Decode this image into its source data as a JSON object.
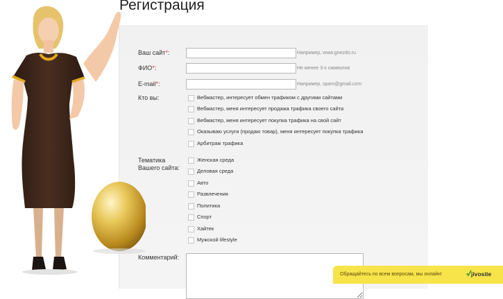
{
  "page": {
    "title": "Регистрация"
  },
  "form": {
    "site": {
      "label": "Ваш сайт",
      "required_mark": "*",
      "colon": ":",
      "value": "",
      "hint": "Например, www.gnezdo.ru"
    },
    "fio": {
      "label": "ФИО",
      "required_mark": "*",
      "colon": ":",
      "value": "",
      "hint": "Не менее 3-х символов"
    },
    "email": {
      "label": "E-mail",
      "required_mark": "*",
      "colon": ":",
      "value": "",
      "hint": "Например, spam@gmail.com"
    },
    "who": {
      "label": "Кто вы:",
      "options": [
        "Вебмастер, интересует обмен трафиком с другими сайтами",
        "Вебмастер, меня интересует продажа трафика своего сайта",
        "Вебмастер, меня интересует покупка трафика на свой сайт",
        "Оказываю услуги (продаю товар), меня интересует покупка трафика",
        "Арбитраж трафика"
      ]
    },
    "topic": {
      "label_line1": "Тематика",
      "label_line2": "Вашего сайта:",
      "options": [
        "Женская среда",
        "Деловая среда",
        "Авто",
        "Развлечения",
        "Политика",
        "Спорт",
        "Хайтек",
        "Мужской lifestyle"
      ]
    },
    "comment": {
      "label": "Комментарий:",
      "value": ""
    }
  },
  "chat": {
    "message": "Обращайтесь по всем вопросам, мы онлайн!",
    "logo": "jivosite",
    "color": "#f7e34a"
  },
  "colors": {
    "required": "#d63b2b",
    "panel": "#f2f2f2"
  }
}
